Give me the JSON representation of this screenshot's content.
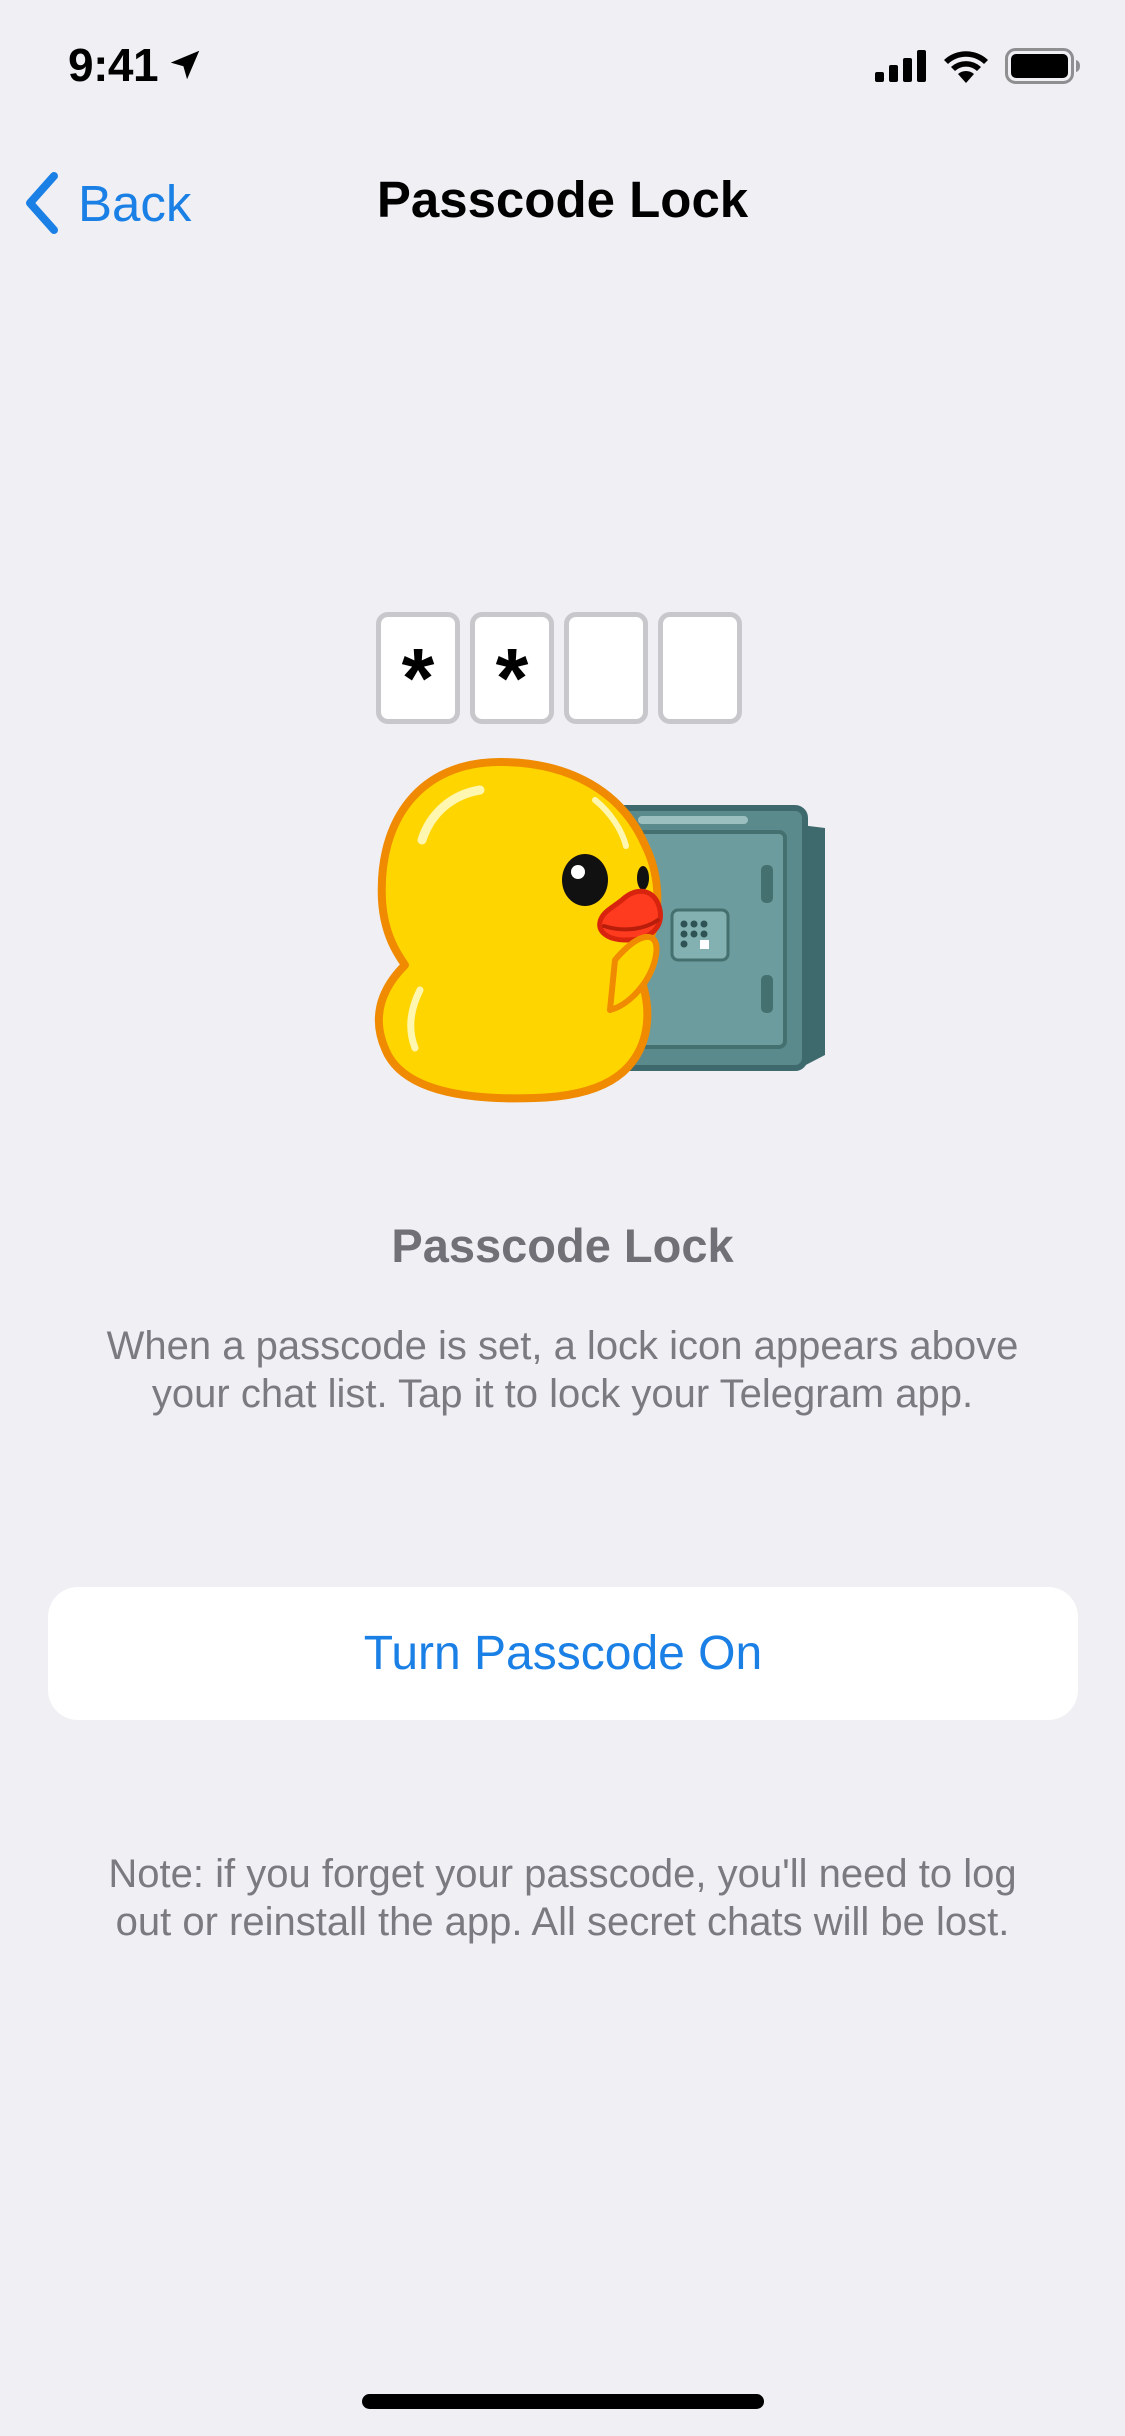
{
  "status_bar": {
    "time": "9:41",
    "icons": [
      "location-arrow-icon",
      "cellular-signal-icon",
      "wifi-icon",
      "battery-icon"
    ]
  },
  "nav": {
    "back_label": "Back",
    "title": "Passcode Lock"
  },
  "illustration": {
    "passcode_slots": [
      "*",
      "*",
      "",
      ""
    ],
    "graphic": "duck-with-safe-sticker"
  },
  "content": {
    "title": "Passcode Lock",
    "description": "When a passcode is set, a lock icon appears above your chat list. Tap it to lock your Telegram app.",
    "button_label": "Turn Passcode On",
    "note": "Note: if you forget your passcode, you'll need to log out or reinstall the app. All secret chats will be lost."
  },
  "colors": {
    "accent": "#1a80e6",
    "background": "#efeff4",
    "secondary_text": "#7a7a80"
  }
}
